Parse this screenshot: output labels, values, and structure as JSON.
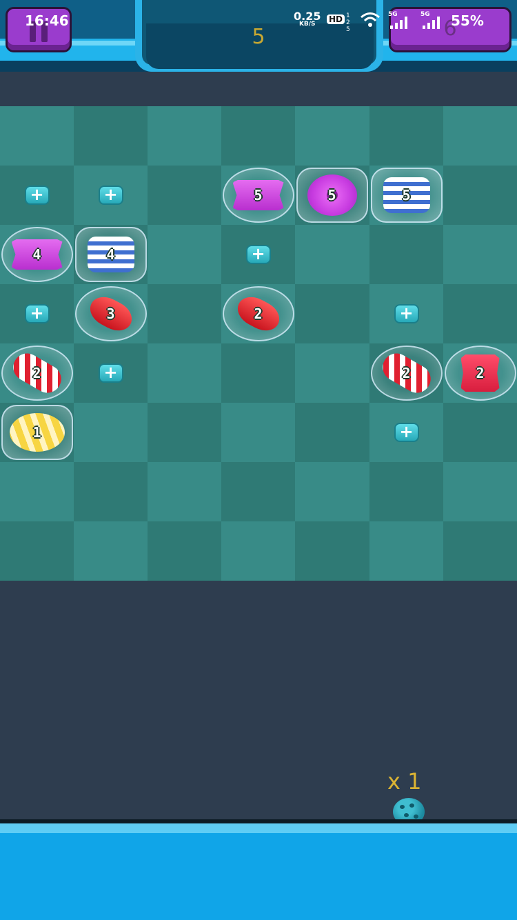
{
  "status_bar": {
    "time": "16:46",
    "net_speed": "0.25",
    "net_unit": "KB/S",
    "hd": "HD",
    "sim_slots": "1\n2\n5",
    "network_1": "5G",
    "network_2": "5G",
    "battery": "55%"
  },
  "game": {
    "level": "5",
    "moves": "6",
    "ammo_count": "x 1"
  },
  "colors": {
    "board_light": "#388b87",
    "board_dark": "#2f7a75",
    "background": "#2e3d4f",
    "accent_purple": "#9a3ccd",
    "accent_blue": "#21b4ec"
  },
  "board": {
    "rows": 8,
    "cols": 7,
    "plus_tiles": [
      {
        "row": 1,
        "col": 0
      },
      {
        "row": 1,
        "col": 1
      },
      {
        "row": 2,
        "col": 3
      },
      {
        "row": 3,
        "col": 0
      },
      {
        "row": 3,
        "col": 5
      },
      {
        "row": 4,
        "col": 1
      },
      {
        "row": 5,
        "col": 5
      }
    ],
    "candies": [
      {
        "row": 1,
        "col": 3,
        "type": "wrapped-purple",
        "value": "5"
      },
      {
        "row": 1,
        "col": 4,
        "type": "donut-purple",
        "value": "5"
      },
      {
        "row": 1,
        "col": 5,
        "type": "striped-blue",
        "value": "5"
      },
      {
        "row": 2,
        "col": 0,
        "type": "wrapped-purple",
        "value": "4"
      },
      {
        "row": 2,
        "col": 1,
        "type": "striped-blue",
        "value": "4"
      },
      {
        "row": 3,
        "col": 1,
        "type": "jellybean-red",
        "value": "3"
      },
      {
        "row": 3,
        "col": 3,
        "type": "jellybean-red",
        "value": "2"
      },
      {
        "row": 4,
        "col": 0,
        "type": "candycane-red",
        "value": "2"
      },
      {
        "row": 4,
        "col": 5,
        "type": "candycane-red",
        "value": "2"
      },
      {
        "row": 4,
        "col": 6,
        "type": "wrapped-red",
        "value": "2"
      },
      {
        "row": 5,
        "col": 0,
        "type": "ball-yellow",
        "value": "1"
      }
    ]
  }
}
